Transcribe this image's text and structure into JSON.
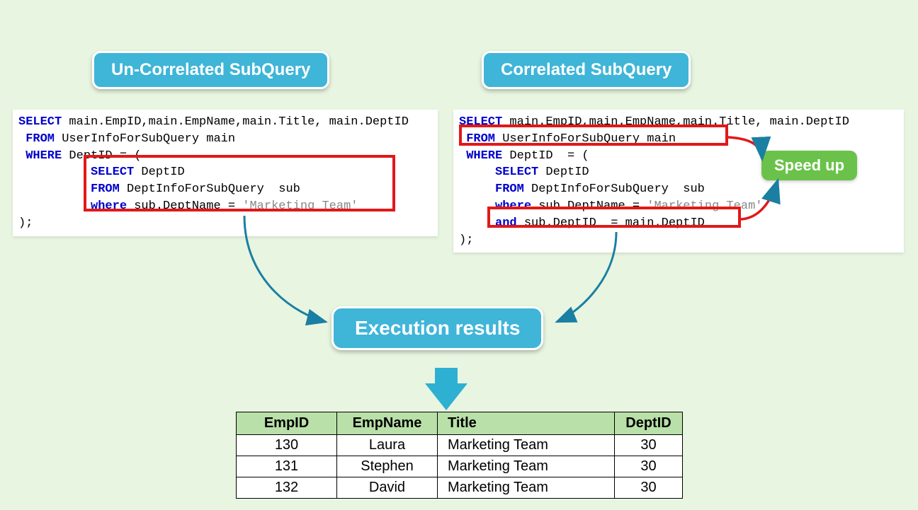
{
  "badges": {
    "uncorrelated": "Un-Correlated SubQuery",
    "correlated": "Correlated SubQuery",
    "results": "Execution results",
    "speedup": "Speed up"
  },
  "code_left": {
    "l1a": "SELECT",
    "l1b": " main.EmpID,main.EmpName,main.Title, main.DeptID",
    "l2a": " FROM",
    "l2b": " UserInfoForSubQuery main",
    "l3a": " WHERE",
    "l3b": " DeptID = (",
    "l4a": "          SELECT",
    "l4b": " DeptID",
    "l5a": "          FROM",
    "l5b": " DeptInfoForSubQuery  sub",
    "l6a": "          where",
    "l6b": " sub.DeptName = ",
    "l6c": "'Marketing Team'",
    "l7": ");"
  },
  "code_right": {
    "l1a": "SELECT",
    "l1b": " main.EmpID,main.EmpName,main.Title, main.DeptID",
    "l2a": " FROM",
    "l2b": " UserInfoForSubQuery main",
    "l3a": " WHERE",
    "l3b": " DeptID  = (",
    "l4a": "     SELECT",
    "l4b": " DeptID",
    "l5a": "     FROM",
    "l5b": " DeptInfoForSubQuery  sub",
    "l6a": "     where",
    "l6b": " sub.DeptName = ",
    "l6c": "'Marketing Team'",
    "l7a": "     and",
    "l7b": " sub.DeptID  = main.DeptID",
    "l8": ");"
  },
  "table": {
    "headers": [
      "EmpID",
      "EmpName",
      "Title",
      "DeptID"
    ],
    "rows": [
      [
        "130",
        "Laura",
        "Marketing Team",
        "30"
      ],
      [
        "131",
        "Stephen",
        "Marketing Team",
        "30"
      ],
      [
        "132",
        "David",
        "Marketing Team",
        "30"
      ]
    ]
  }
}
